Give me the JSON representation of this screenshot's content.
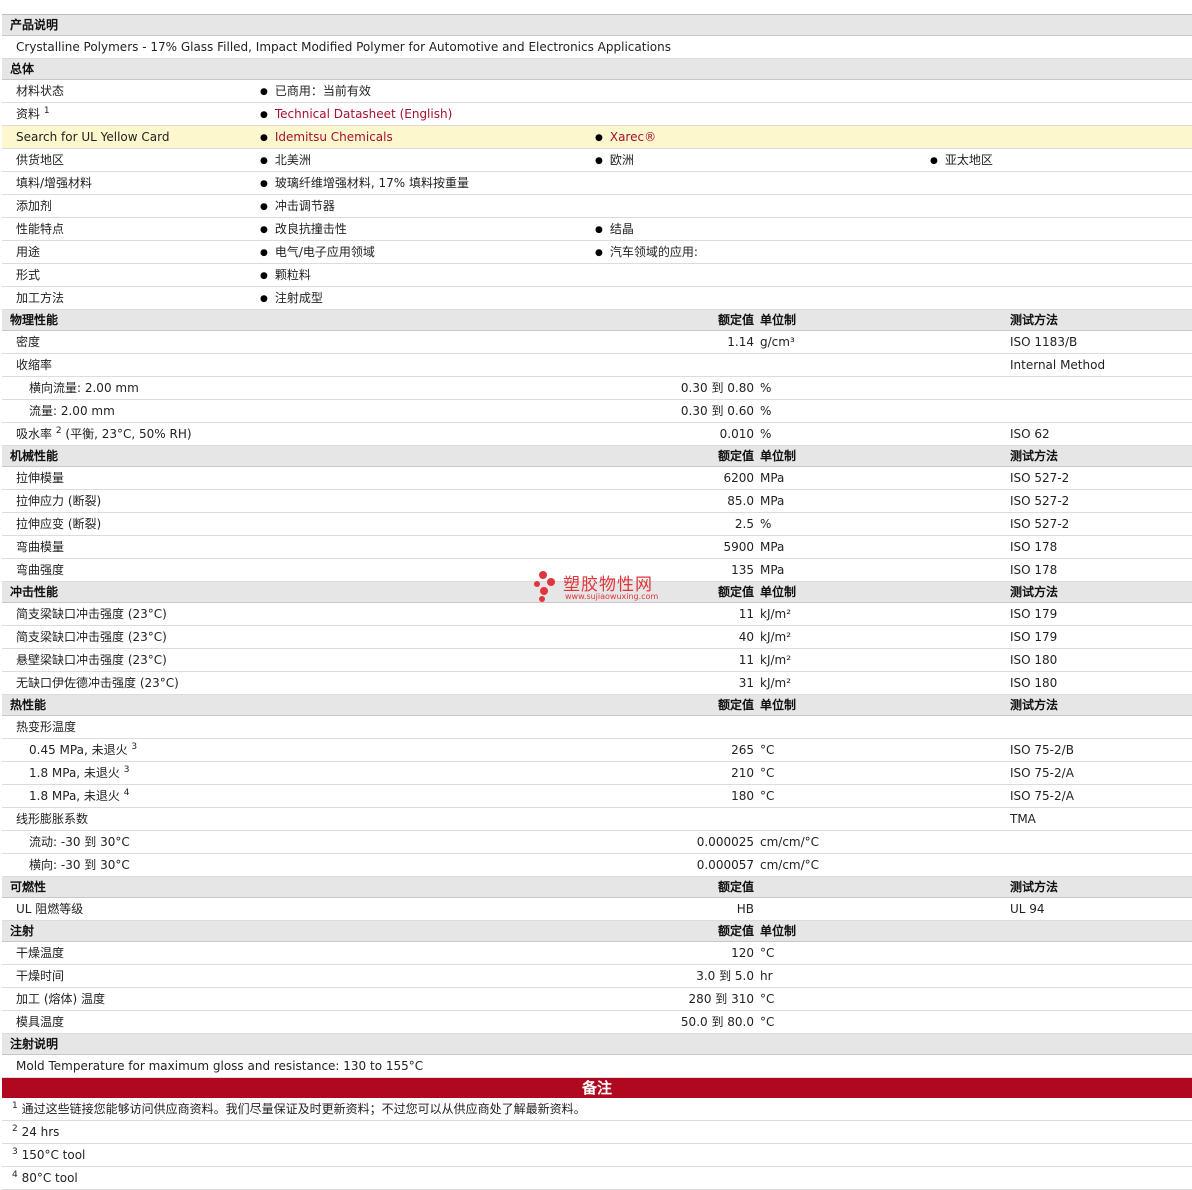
{
  "sections": {
    "desc": "产品说明",
    "general": "总体",
    "physical": "物理性能",
    "mechanical": "机械性能",
    "impact": "冲击性能",
    "thermal": "热性能",
    "flammability": "可燃性",
    "injection": "注射",
    "injection_notes": "注射说明",
    "notes": "备注"
  },
  "col_headers": {
    "value": "额定值",
    "unit": "单位制",
    "test": "测试方法"
  },
  "description": "Crystalline Polymers - 17% Glass Filled, Impact Modified Polymer for Automotive and Electronics Applications",
  "general": {
    "status_label": "材料状态",
    "status": "已商用：当前有效",
    "source_label": "资料",
    "source_sup": "1",
    "source_link": "Technical Datasheet (English)",
    "ul_label": "Search for UL Yellow Card",
    "ul_links": [
      "Idemitsu Chemicals",
      "Xarec®"
    ],
    "region_label": "供货地区",
    "regions": [
      "北美洲",
      "欧洲",
      "亚太地区"
    ],
    "filler_label": "填料/增强材料",
    "filler": "玻璃纤维增强材料, 17% 填料按重量",
    "additive_label": "添加剂",
    "additive": "冲击调节器",
    "features_label": "性能特点",
    "features": [
      "改良抗撞击性",
      "结晶"
    ],
    "uses_label": "用途",
    "uses": [
      "电气/电子应用领域",
      "汽车领域的应用:"
    ],
    "form_label": "形式",
    "form": "颗粒料",
    "process_label": "加工方法",
    "process": "注射成型"
  },
  "physical": {
    "density": {
      "label": "密度",
      "value": "1.14",
      "unit": "g/cm³",
      "test": "ISO 1183/B"
    },
    "shrink": {
      "label": "收缩率",
      "test": "Internal Method"
    },
    "shrink_cross": {
      "label": "横向流量: 2.00 mm",
      "value": "0.30 到  0.80",
      "unit": "%"
    },
    "shrink_flow": {
      "label": "流量: 2.00 mm",
      "value": "0.30 到  0.60",
      "unit": "%"
    },
    "water": {
      "label": "吸水率",
      "sup": "2",
      "label_tail": "(平衡, 23°C, 50% RH)",
      "value": "0.010",
      "unit": "%",
      "test": "ISO 62"
    }
  },
  "mechanical": [
    {
      "label": "拉伸模量",
      "value": "6200",
      "unit": "MPa",
      "test": "ISO 527-2"
    },
    {
      "label": "拉伸应力 (断裂)",
      "value": "85.0",
      "unit": "MPa",
      "test": "ISO 527-2"
    },
    {
      "label": "拉伸应变 (断裂)",
      "value": "2.5",
      "unit": "%",
      "test": "ISO 527-2"
    },
    {
      "label": "弯曲模量",
      "value": "5900",
      "unit": "MPa",
      "test": "ISO 178"
    },
    {
      "label": "弯曲强度",
      "value": "135",
      "unit": "MPa",
      "test": "ISO 178"
    }
  ],
  "impact": [
    {
      "label": "简支梁缺口冲击强度 (23°C)",
      "value": "11",
      "unit": "kJ/m²",
      "test": "ISO 179"
    },
    {
      "label": "简支梁缺口冲击强度 (23°C)",
      "value": "40",
      "unit": "kJ/m²",
      "test": "ISO 179"
    },
    {
      "label": "悬壁梁缺口冲击强度 (23°C)",
      "value": "11",
      "unit": "kJ/m²",
      "test": "ISO 180"
    },
    {
      "label": "无缺口伊佐德冲击强度 (23°C)",
      "value": "31",
      "unit": "kJ/m²",
      "test": "ISO 180"
    }
  ],
  "thermal": {
    "hdt_label": "热变形温度",
    "hdt": [
      {
        "label": "0.45 MPa, 未退火",
        "sup": "3",
        "value": "265",
        "unit": "°C",
        "test": "ISO 75-2/B"
      },
      {
        "label": "1.8 MPa, 未退火",
        "sup": "3",
        "value": "210",
        "unit": "°C",
        "test": "ISO 75-2/A"
      },
      {
        "label": "1.8 MPa, 未退火",
        "sup": "4",
        "value": "180",
        "unit": "°C",
        "test": "ISO 75-2/A"
      }
    ],
    "clte_label": "线形膨胀系数",
    "clte_test": "TMA",
    "clte": [
      {
        "label": "流动: -30 到  30°C",
        "value": "0.000025",
        "unit": "cm/cm/°C"
      },
      {
        "label": "横向: -30 到  30°C",
        "value": "0.000057",
        "unit": "cm/cm/°C"
      }
    ]
  },
  "flammability": {
    "label": "UL 阻燃等级",
    "value": "HB",
    "test": "UL 94"
  },
  "injection": [
    {
      "label": "干燥温度",
      "value": "120",
      "unit": "°C"
    },
    {
      "label": "干燥时间",
      "value": "3.0 到  5.0",
      "unit": "hr"
    },
    {
      "label": "加工 (熔体) 温度",
      "value": "280 到  310",
      "unit": "°C"
    },
    {
      "label": "模具温度",
      "value": "50.0 到  80.0",
      "unit": "°C"
    }
  ],
  "injection_note": "Mold Temperature for maximum gloss and resistance: 130 to 155°C",
  "footnotes": [
    {
      "n": "1",
      "text": "通过这些链接您能够访问供应商资料。我们尽量保证及时更新资料；不过您可以从供应商处了解最新资料。"
    },
    {
      "n": "2",
      "text": "24 hrs"
    },
    {
      "n": "3",
      "text": "150°C tool"
    },
    {
      "n": "4",
      "text": "80°C tool"
    }
  ],
  "watermark": {
    "name": "塑胶物性网",
    "url": "www.sujiaowuxing.com"
  },
  "colors": {
    "accent": "#b0081e",
    "link": "#a4102e",
    "highlight": "#fdf7cd",
    "header_bg": "#e6e6e6"
  }
}
